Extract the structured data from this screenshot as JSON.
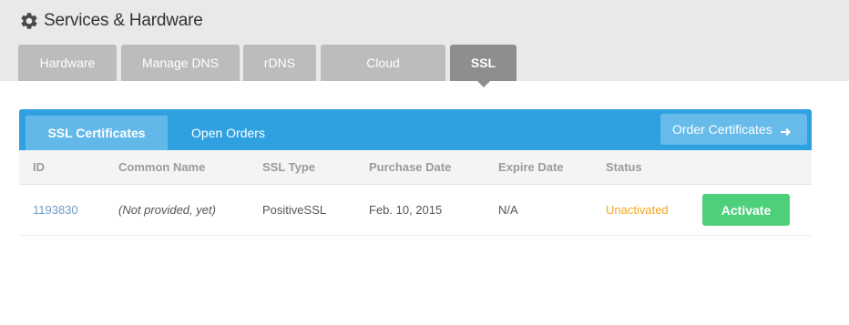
{
  "page": {
    "title": "Services & Hardware",
    "icon": "gear-icon"
  },
  "nav_tabs": [
    {
      "label": "Hardware",
      "active": false
    },
    {
      "label": "Manage DNS",
      "active": false
    },
    {
      "label": "rDNS",
      "active": false
    },
    {
      "label": "Cloud",
      "active": false
    },
    {
      "label": "SSL",
      "active": true
    }
  ],
  "panel": {
    "tabs": [
      {
        "label": "SSL Certificates",
        "active": true
      },
      {
        "label": "Open Orders",
        "active": false
      }
    ],
    "order_button": {
      "label": "Order Certificates",
      "icon": "arrow-right-icon"
    }
  },
  "table": {
    "columns": [
      "ID",
      "Common Name",
      "SSL Type",
      "Purchase Date",
      "Expire Date",
      "Status"
    ],
    "rows": [
      {
        "id": "1193830",
        "common_name": "(Not provided, yet)",
        "ssl_type": "PositiveSSL",
        "purchase_date": "Feb. 10, 2015",
        "expire_date": "N/A",
        "status": "Unactivated",
        "action": "Activate"
      }
    ]
  },
  "colors": {
    "header_bg": "#e9e9e9",
    "tab_inactive": "#bcbcbc",
    "tab_active": "#8e8e8e",
    "panel_blue": "#2fa1e0",
    "link_blue": "#6f9cc3",
    "status_orange": "#f5a623",
    "activate_green": "#4ed07b"
  }
}
